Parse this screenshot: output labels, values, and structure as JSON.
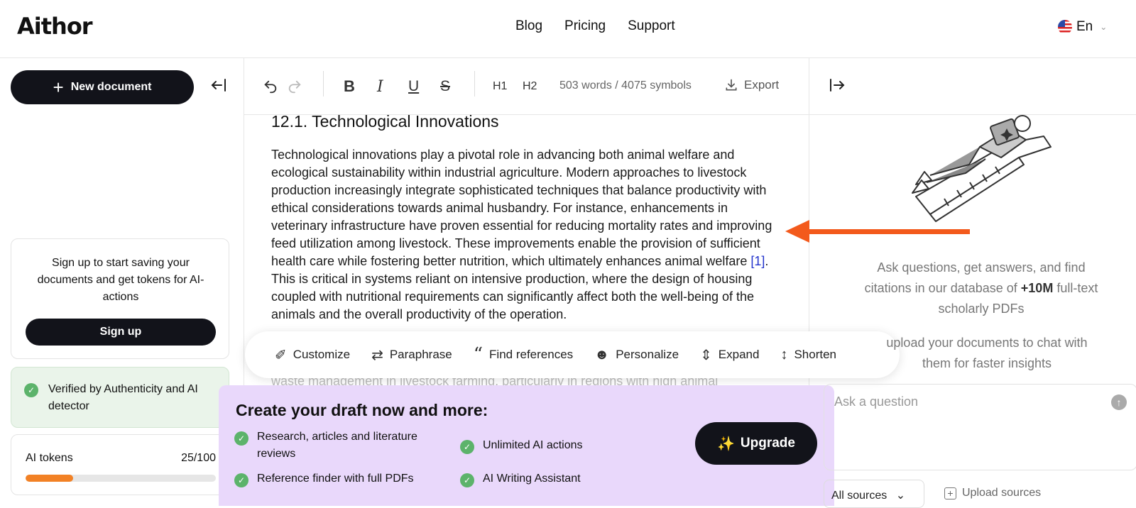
{
  "header": {
    "logo": "Aithor",
    "nav": [
      "Blog",
      "Pricing",
      "Support"
    ],
    "language": "En"
  },
  "sidebar": {
    "new_document": "New document",
    "signup_prompt": "Sign up to start saving your documents and get tokens for AI-actions",
    "signup_button": "Sign up",
    "verified_text": "Verified by Authenticity and AI detector",
    "tokens_label": "AI tokens",
    "tokens_value": "25/100",
    "tokens_used_fraction": 0.25
  },
  "toolbar": {
    "h1": "H1",
    "h2": "H2",
    "word_count": "503 words / 4075 symbols",
    "export": "Export"
  },
  "document": {
    "heading": "12.1. Technological Innovations",
    "paragraph_a": "Technological innovations play a pivotal role in advancing both animal welfare and ecological sustainability within industrial agriculture. Modern approaches to livestock production increasingly integrate sophisticated techniques that balance productivity with ethical considerations towards animal husbandry. For instance, enhancements in veterinary infrastructure have proven essential for reducing mortality rates and improving feed utilization among livestock. These improvements enable the provision of sufficient health care while fostering better nutrition, which ultimately enhances animal welfare ",
    "citation": "[1]",
    "paragraph_b": ". This is critical in systems reliant on intensive production, where the design of housing coupled with nutritional requirements can significantly affect both the well-being of the animals and the overall productivity of the operation.",
    "paragraph_faded": "waste management in livestock farming, particularly in regions with high animal"
  },
  "actions": [
    "Customize",
    "Paraphrase",
    "Find references",
    "Personalize",
    "Expand",
    "Shorten"
  ],
  "promo": {
    "title": "Create your draft now and more:",
    "features": [
      "Research, articles and literature reviews",
      "Reference finder with full PDFs",
      "Unlimited AI actions",
      "AI Writing Assistant"
    ],
    "upgrade": "Upgrade"
  },
  "right_panel": {
    "ask_text_a": "Ask questions, get answers, and find citations in our database of ",
    "ask_text_bold": "+10M",
    "ask_text_b": " full-text scholarly PDFs",
    "upload_text": "upload your documents to chat with them for faster insights",
    "ask_placeholder": "Ask a question",
    "all_sources": "All sources",
    "upload_sources": "Upload sources"
  },
  "colors": {
    "accent_dark": "#12131a",
    "progress": "#f28125",
    "promo_bg": "#e9d8fb",
    "check": "#5cb36b",
    "arrow": "#f35a1c"
  }
}
